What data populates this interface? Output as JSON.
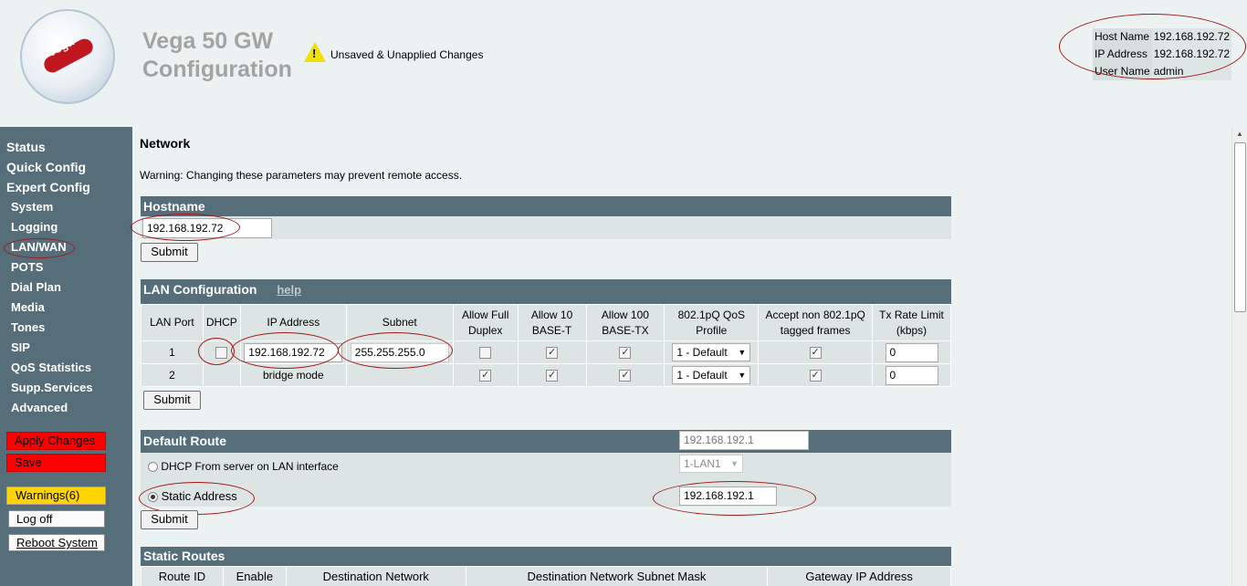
{
  "header": {
    "title_line1": "Vega 50 GW",
    "title_line2": "Configuration",
    "logo_text": "Vega",
    "warning_text": "Unsaved & Unapplied Changes",
    "host_name_label": "Host Name",
    "host_name_value": "192.168.192.72",
    "ip_address_label": "IP Address",
    "ip_address_value": "192.168.192.72",
    "user_name_label": "User Name",
    "user_name_value": "admin"
  },
  "sidebar": {
    "top_items": [
      "Status",
      "Quick Config",
      "Expert Config"
    ],
    "sub_items": [
      "System",
      "Logging",
      "LAN/WAN",
      "POTS",
      "Dial Plan",
      "Media",
      "Tones",
      "SIP",
      "QoS Statistics",
      "Supp.Services",
      "Advanced"
    ],
    "apply_changes": "Apply Changes",
    "save": "Save",
    "warnings": "Warnings(6)",
    "log_off": "Log off",
    "reboot": "Reboot System"
  },
  "page": {
    "title": "Network",
    "warning": "Warning: Changing these parameters may prevent remote access."
  },
  "hostname": {
    "heading": "Hostname",
    "value": "192.168.192.72",
    "submit": "Submit"
  },
  "lan": {
    "heading": "LAN Configuration",
    "help": "help",
    "columns": [
      "LAN Port",
      "DHCP",
      "IP Address",
      "Subnet",
      "Allow Full Duplex",
      "Allow 10 BASE-T",
      "Allow 100 BASE-TX",
      "802.1pQ QoS Profile",
      "Accept non 802.1pQ tagged frames",
      "Tx Rate Limit (kbps)"
    ],
    "rows": [
      {
        "port": "1",
        "ip": "192.168.192.72",
        "subnet": "255.255.255.0",
        "qos": "1 - Default",
        "tx": "0"
      },
      {
        "port": "2",
        "bridge": "bridge mode",
        "qos": "1 - Default",
        "tx": "0"
      }
    ],
    "submit": "Submit"
  },
  "route": {
    "heading": "Default Route",
    "gateway_display": "192.168.192.1",
    "dhcp_label": "DHCP From server on LAN interface",
    "interface": "1-LAN1",
    "static_label": "Static Address",
    "static_value": "192.168.192.1",
    "submit": "Submit"
  },
  "static_routes": {
    "heading": "Static Routes",
    "columns": [
      "Route ID",
      "Enable",
      "Destination Network",
      "Destination Network Subnet Mask",
      "Gateway IP Address"
    ]
  },
  "colors": {
    "sidebar": "#556e79",
    "background": "#ecf2f2",
    "annotation": "#a01818",
    "apply": "#ff0000",
    "warnings": "#ffd400"
  }
}
